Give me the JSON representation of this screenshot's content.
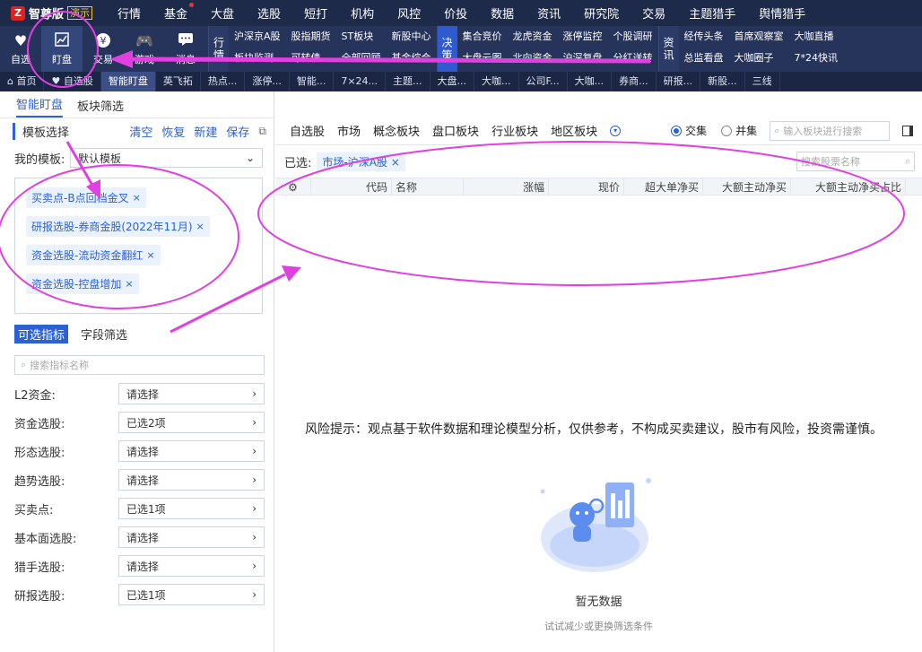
{
  "brand": {
    "logo_char": "Z",
    "name": "智尊版",
    "tag": "演示"
  },
  "topnav": [
    {
      "label": "行情"
    },
    {
      "label": "基金",
      "dot": true
    },
    {
      "label": "大盘"
    },
    {
      "label": "选股"
    },
    {
      "label": "短打"
    },
    {
      "label": "机构"
    },
    {
      "label": "风控"
    },
    {
      "label": "价投"
    },
    {
      "label": "数据"
    },
    {
      "label": "资讯"
    },
    {
      "label": "研究院"
    },
    {
      "label": "交易"
    },
    {
      "label": "主题猎手"
    },
    {
      "label": "舆情猎手"
    }
  ],
  "toolbar": {
    "icons": [
      {
        "label": "自选",
        "icon": "heart-icon"
      },
      {
        "label": "盯盘",
        "icon": "chart-icon"
      },
      {
        "label": "交易",
        "icon": "yen-icon"
      },
      {
        "label": "游戏",
        "icon": "gamepad-icon"
      },
      {
        "label": "消息",
        "icon": "message-icon"
      }
    ],
    "groups": [
      {
        "label": "行情",
        "items": [
          "沪深京A股",
          "板块监测",
          "股指期货",
          "可转债",
          "ST板块",
          "全部回顾",
          "新股中心",
          "基金综合"
        ]
      },
      {
        "label": "决策",
        "items": [
          "集合竞价",
          "大盘云图",
          "龙虎资金",
          "北向资金",
          "涨停监控",
          "沪深复盘",
          "个股调研",
          "分红送转"
        ]
      },
      {
        "label": "资讯",
        "items": [
          "经传头条",
          "总监看盘",
          "首席观察室",
          "大咖圈子",
          "大咖直播",
          "7*24快讯"
        ]
      }
    ]
  },
  "tabs": [
    "首页",
    "自选股",
    "智能盯盘",
    "英飞拓",
    "热点...",
    "涨停...",
    "智能...",
    "7×24...",
    "主题...",
    "大盘...",
    "大咖...",
    "公司F...",
    "大咖...",
    "券商...",
    "研报...",
    "新股...",
    "三线"
  ],
  "left": {
    "tabs": [
      "智能盯盘",
      "板块筛选"
    ],
    "tpl_title": "模板选择",
    "tpl_actions": [
      "清空",
      "恢复",
      "新建",
      "保存"
    ],
    "my_template_label": "我的模板:",
    "my_template_value": "默认模板",
    "chips": [
      "买卖点-B点回档金叉",
      "研报选股-券商金股(2022年11月)",
      "资金选股-流动资金翻红",
      "资金选股-控盘增加"
    ],
    "ind_tabs": [
      "可选指标",
      "字段筛选"
    ],
    "ind_search_placeholder": "搜索指标名称",
    "indicators": [
      {
        "label": "L2资金:",
        "value": "请选择"
      },
      {
        "label": "资金选股:",
        "value": "已选2项"
      },
      {
        "label": "形态选股:",
        "value": "请选择"
      },
      {
        "label": "趋势选股:",
        "value": "请选择"
      },
      {
        "label": "买卖点:",
        "value": "已选1项"
      },
      {
        "label": "基本面选股:",
        "value": "请选择"
      },
      {
        "label": "猎手选股:",
        "value": "请选择"
      },
      {
        "label": "研报选股:",
        "value": "已选1项"
      }
    ]
  },
  "right": {
    "tabs": [
      "自选股",
      "市场",
      "概念板块",
      "盘口板块",
      "行业板块",
      "地区板块"
    ],
    "radio_intersect": "交集",
    "radio_union": "并集",
    "search_placeholder": "输入板块进行搜索",
    "selected_label": "已选:",
    "selected_chip": "市场-沪深A股",
    "stock_search_placeholder": "搜索股票名称",
    "columns": [
      "代码",
      "名称",
      "涨幅",
      "现价",
      "超大单净买",
      "大额主动净买",
      "大额主动净买占比"
    ],
    "risk_text": "风险提示：观点基于软件数据和理论模型分析，仅供参考，不构成买卖建议，股市有风险，投资需谨慎。",
    "empty_title": "暂无数据",
    "empty_sub": "试试减少或更换筛选条件"
  },
  "colors": {
    "accent": "#2a62d6",
    "annotation": "#e040e0",
    "nav_bg": "#1e2a4a"
  }
}
